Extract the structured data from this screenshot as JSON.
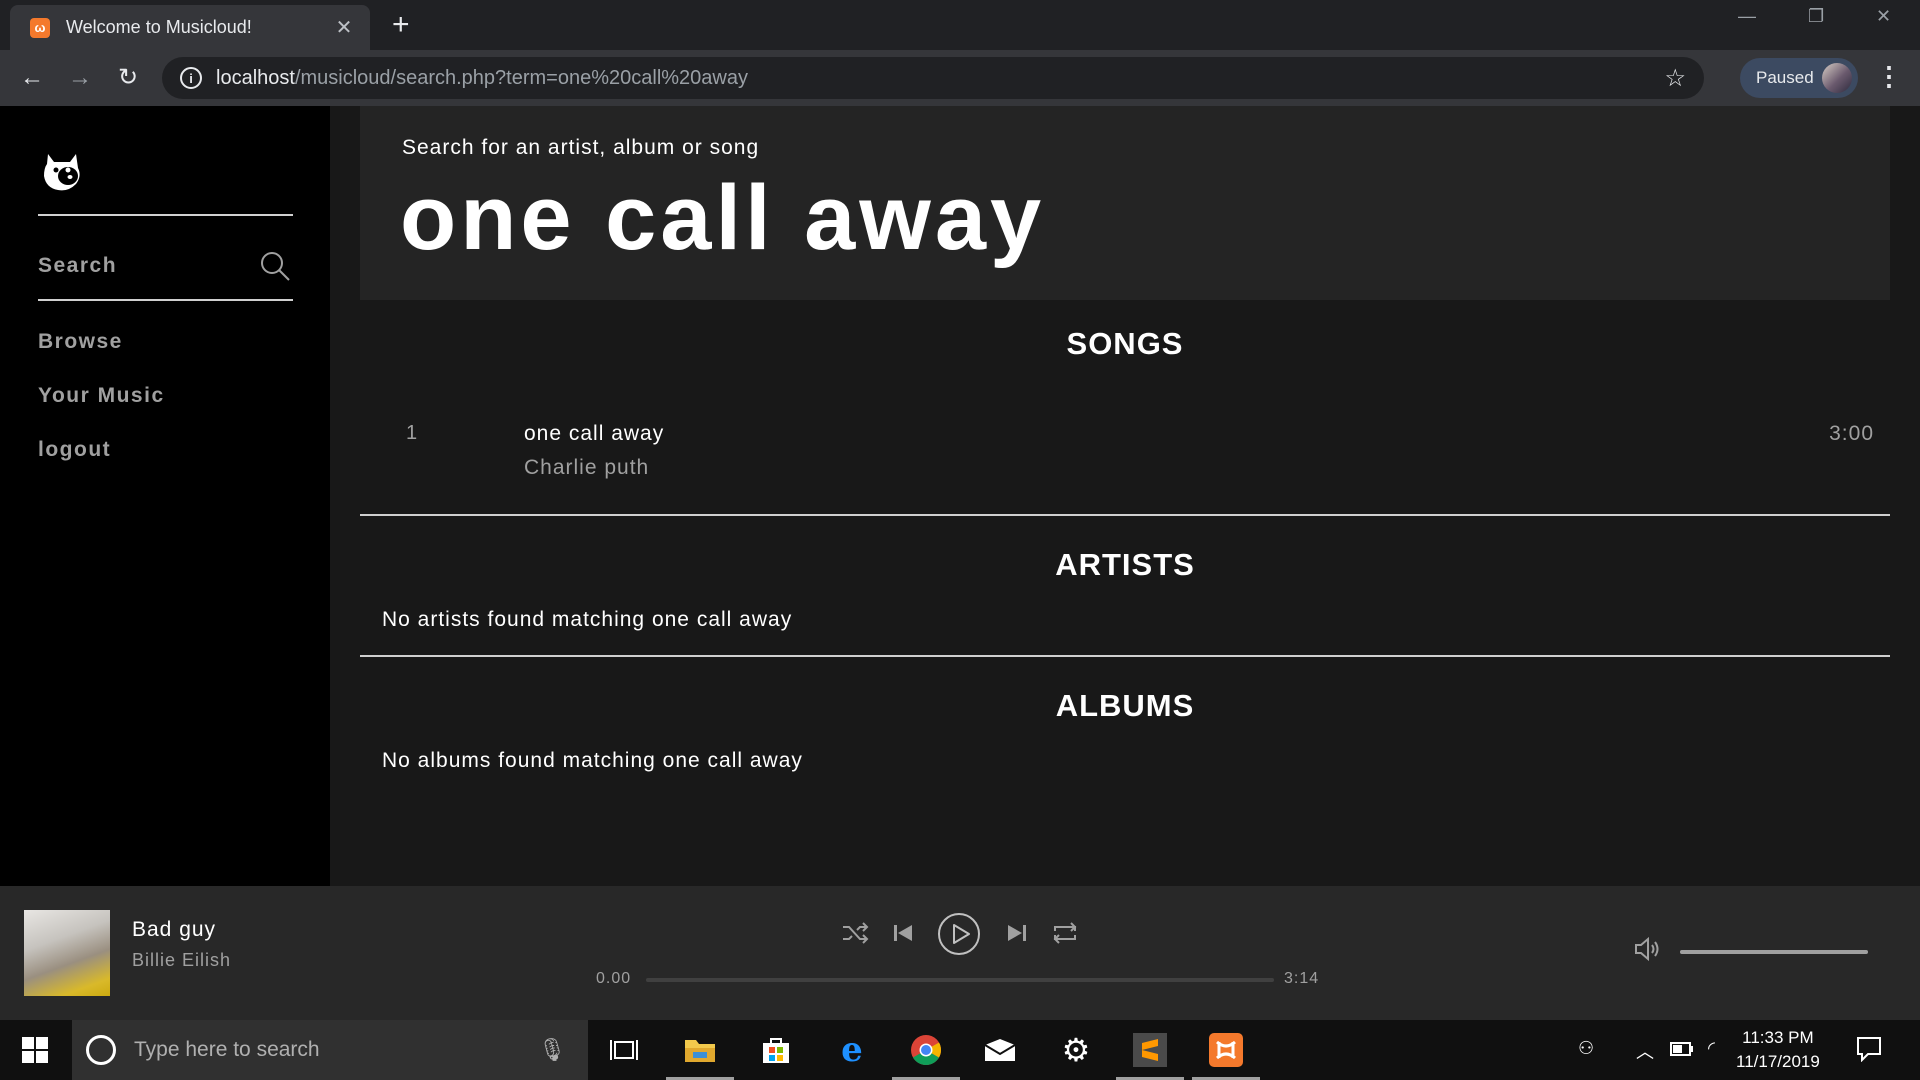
{
  "browser": {
    "tab_title": "Welcome to Musicloud!",
    "tab_close": "✕",
    "new_tab": "+",
    "url_host": "localhost",
    "url_path": "/musicloud/search.php?term=one%20call%20away",
    "profile_status": "Paused",
    "icons": [
      "back-arrow-icon",
      "forward-arrow-icon",
      "reload-icon",
      "info-icon",
      "star-icon",
      "menu-icon"
    ]
  },
  "sidebar": {
    "search_label": "Search",
    "nav": [
      {
        "label": "Browse"
      },
      {
        "label": "Your Music"
      },
      {
        "label": "logout"
      }
    ]
  },
  "search": {
    "hint": "Search for an artist, album or song",
    "term": "one call away"
  },
  "sections": {
    "songs_title": "SONGS",
    "artists_title": "ARTISTS",
    "albums_title": "ALBUMS"
  },
  "songs": [
    {
      "number": "1",
      "name": "one call away",
      "artist": "Charlie puth",
      "duration": "3:00"
    }
  ],
  "artists_empty": "No artists found matching one call away",
  "albums_empty": "No albums found matching one call away",
  "player": {
    "title": "Bad guy",
    "artist": "Billie Eilish",
    "current_time": "0.00",
    "total_time": "3:14",
    "progress": 0,
    "volume": 1.0
  },
  "taskbar": {
    "search_placeholder": "Type here to search",
    "time": "11:33 PM",
    "date": "11/17/2019"
  },
  "colors": {
    "sidebar_bg": "#000000",
    "main_bg": "#181818",
    "search_box_bg": "#242424",
    "player_bg": "#282828",
    "muted_text": "#a0a0a0",
    "favicon": "#f4792c"
  }
}
